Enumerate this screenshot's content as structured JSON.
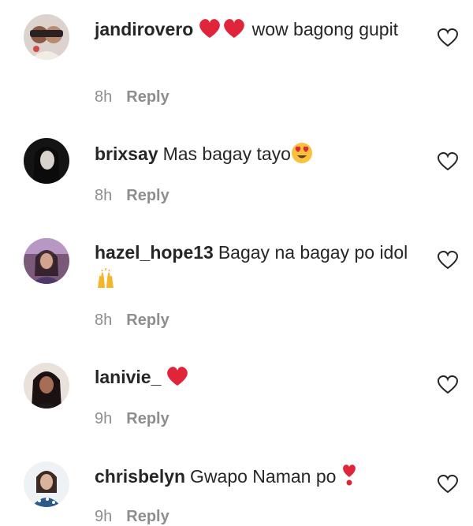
{
  "comments": [
    {
      "username": "jandirovero",
      "text_before": "",
      "text_after": "wow bagong gupit",
      "emoji": "two-red-hearts",
      "time": "8h",
      "reply": "Reply"
    },
    {
      "username": "brixsay",
      "text_before": "Mas bagay tayo",
      "text_after": "",
      "emoji": "heart-eyes",
      "time": "8h",
      "reply": "Reply"
    },
    {
      "username": "hazel_hope13",
      "text_before": "Bagay na bagay po idol",
      "text_after": "",
      "emoji": "raised-hands",
      "time": "8h",
      "reply": "Reply"
    },
    {
      "username": "lanivie_",
      "text_before": "",
      "text_after": "",
      "emoji": "red-heart",
      "time": "9h",
      "reply": "Reply"
    },
    {
      "username": "chrisbelyn",
      "text_before": "Gwapo Naman po",
      "text_after": "",
      "emoji": "heart-exclamation",
      "time": "9h",
      "reply": "Reply"
    }
  ],
  "colors": {
    "text": "#262626",
    "meta": "#8e8e8e",
    "heart": "#e0243a",
    "like_icon": "#262626"
  }
}
